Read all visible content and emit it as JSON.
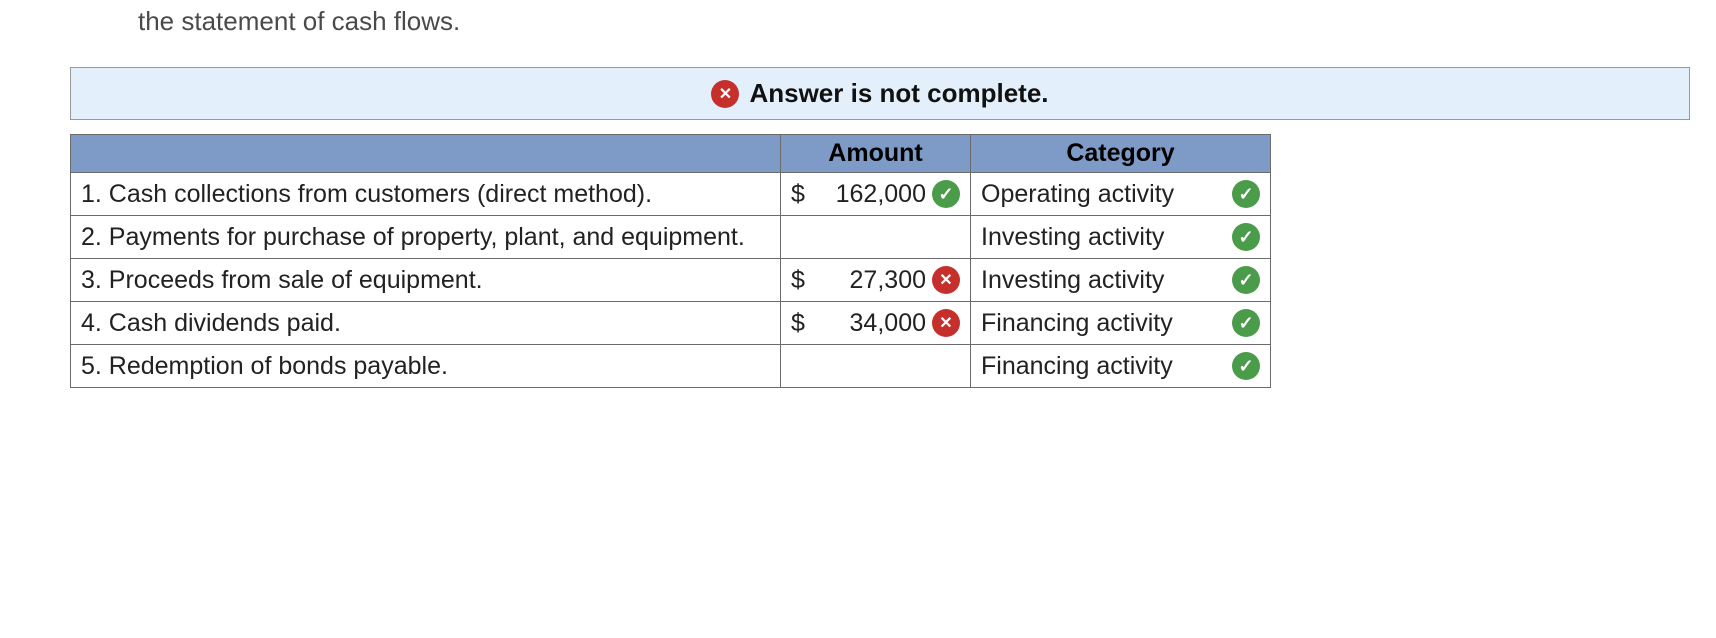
{
  "intro_fragment": "the statement of cash flows.",
  "alert": {
    "text": "Answer is not complete."
  },
  "headers": {
    "desc": "",
    "amount": "Amount",
    "category": "Category"
  },
  "rows": [
    {
      "desc": "1. Cash collections from customers (direct method).",
      "currency": "$",
      "amount": "162,000",
      "amount_mark": "correct",
      "category": "Operating activity",
      "category_mark": "correct"
    },
    {
      "desc": "2. Payments for purchase of property, plant, and equipment.",
      "currency": "",
      "amount": "",
      "amount_mark": "",
      "category": "Investing activity",
      "category_mark": "correct"
    },
    {
      "desc": "3. Proceeds from sale of equipment.",
      "currency": "$",
      "amount": "27,300",
      "amount_mark": "wrong",
      "category": "Investing activity",
      "category_mark": "correct"
    },
    {
      "desc": "4. Cash dividends paid.",
      "currency": "$",
      "amount": "34,000",
      "amount_mark": "wrong",
      "category": "Financing activity",
      "category_mark": "correct"
    },
    {
      "desc": "5. Redemption of bonds payable.",
      "currency": "",
      "amount": "",
      "amount_mark": "",
      "category": "Financing activity",
      "category_mark": "correct"
    }
  ]
}
